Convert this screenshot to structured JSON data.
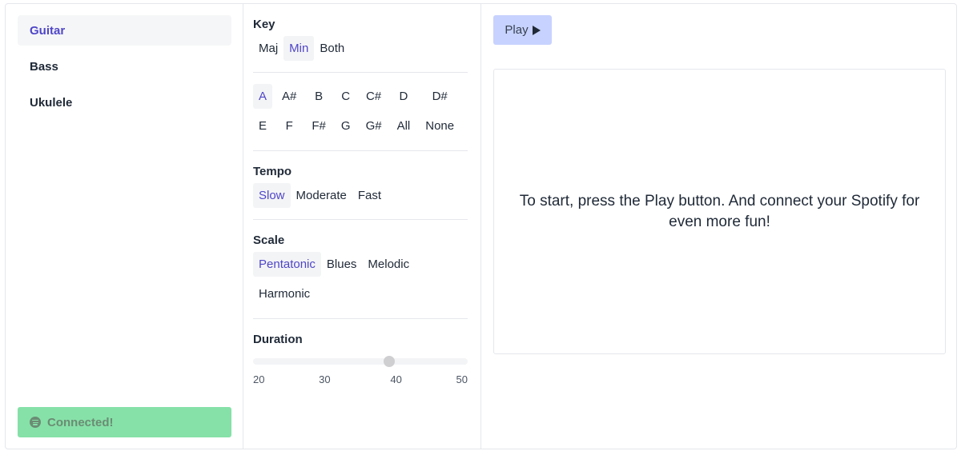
{
  "instruments": [
    "Guitar",
    "Bass",
    "Ukulele"
  ],
  "instrument_selected": "Guitar",
  "spotify": {
    "label": "Connected!",
    "icon": "spotify-icon",
    "color": "#86e1a8"
  },
  "key": {
    "title": "Key",
    "modes": [
      "Maj",
      "Min",
      "Both"
    ],
    "mode_selected": "Min",
    "notes": [
      "A",
      "A#",
      "B",
      "C",
      "C#",
      "D",
      "D#",
      "E",
      "F",
      "F#",
      "G",
      "G#",
      "All",
      "None"
    ],
    "note_selected": "A"
  },
  "tempo": {
    "title": "Tempo",
    "options": [
      "Slow",
      "Moderate",
      "Fast"
    ],
    "selected": "Slow"
  },
  "scale": {
    "title": "Scale",
    "options": [
      "Pentatonic",
      "Blues",
      "Melodic",
      "Harmonic"
    ],
    "selected": "Pentatonic"
  },
  "duration": {
    "title": "Duration",
    "ticks": [
      20,
      30,
      40,
      50
    ],
    "min": 20,
    "max": 50,
    "value": 39
  },
  "play": {
    "label": "Play",
    "icon": "play-icon"
  },
  "message": "To start, press the Play button. And connect your Spotify for even more fun!",
  "colors": {
    "accent": "#4f46c8",
    "play_button": "#c7d2fe",
    "selected_bg": "#f3f4f6",
    "spotify_green": "#86e1a8"
  }
}
